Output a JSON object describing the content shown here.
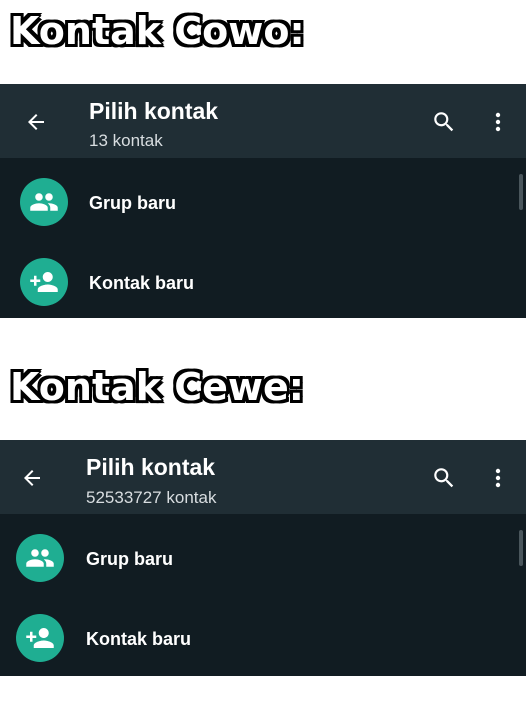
{
  "captions": [
    "Kontak Cowo:",
    "Kontak Cewe:"
  ],
  "panels": [
    {
      "title": "Pilih kontak",
      "subtitle": "13 kontak",
      "items": [
        {
          "label": "Grup baru",
          "icon": "group-icon"
        },
        {
          "label": "Kontak baru",
          "icon": "add-person-icon"
        }
      ]
    },
    {
      "title": "Pilih kontak",
      "subtitle": "52533727 kontak",
      "items": [
        {
          "label": "Grup baru",
          "icon": "group-icon"
        },
        {
          "label": "Kontak baru",
          "icon": "add-person-icon"
        }
      ]
    }
  ],
  "colors": {
    "app_bar": "#202e35",
    "background": "#111c22",
    "accent": "#1fae92",
    "text": "#ffffff"
  }
}
